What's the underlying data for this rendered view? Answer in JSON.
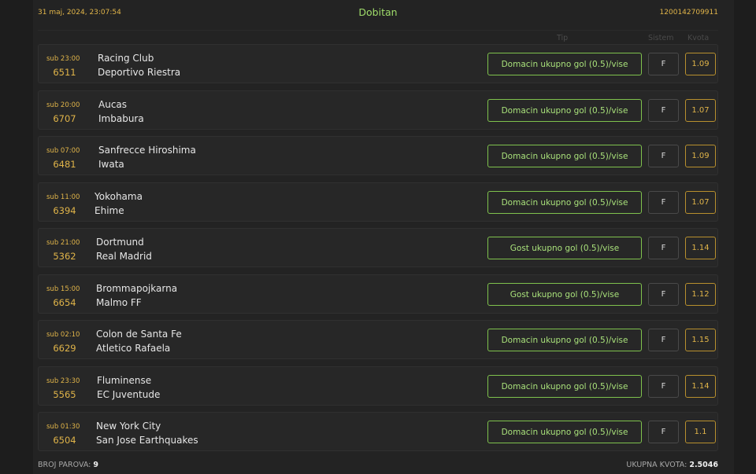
{
  "header": {
    "datetime": "31 maj, 2024, 23:07:54",
    "status": "Dobitan",
    "ticket_id": "1200142709911"
  },
  "columns": {
    "tip": "Tip",
    "sistem": "Sistem",
    "kvota": "Kvota"
  },
  "colors": {
    "accent_green": "#7fc24d",
    "accent_gold": "#e0b449",
    "background": "#1d1d1d"
  },
  "rows": [
    {
      "time": "sub 23:00",
      "code": "6511",
      "home": "Racing Club",
      "away": "Deportivo Riestra",
      "tip": "Domacin ukupno gol (0.5)/vise",
      "sistem": "F",
      "kvota": "1.09"
    },
    {
      "time": "sub 20:00",
      "code": "6707",
      "home": "Aucas",
      "away": "Imbabura",
      "tip": "Domacin ukupno gol (0.5)/vise",
      "sistem": "F",
      "kvota": "1.07"
    },
    {
      "time": "sub 07:00",
      "code": "6481",
      "home": "Sanfrecce Hiroshima",
      "away": "Iwata",
      "tip": "Domacin ukupno gol (0.5)/vise",
      "sistem": "F",
      "kvota": "1.09"
    },
    {
      "time": "sub 11:00",
      "code": "6394",
      "home": "Yokohama",
      "away": "Ehime",
      "tip": "Domacin ukupno gol (0.5)/vise",
      "sistem": "F",
      "kvota": "1.07"
    },
    {
      "time": "sub 21:00",
      "code": "5362",
      "home": "Dortmund",
      "away": "Real Madrid",
      "tip": "Gost ukupno gol (0.5)/vise",
      "sistem": "F",
      "kvota": "1.14"
    },
    {
      "time": "sub 15:00",
      "code": "6654",
      "home": "Brommapojkarna",
      "away": "Malmo FF",
      "tip": "Gost ukupno gol (0.5)/vise",
      "sistem": "F",
      "kvota": "1.12"
    },
    {
      "time": "sub 02:10",
      "code": "6629",
      "home": "Colon de Santa Fe",
      "away": "Atletico Rafaela",
      "tip": "Domacin ukupno gol (0.5)/vise",
      "sistem": "F",
      "kvota": "1.15"
    },
    {
      "time": "sub 23:30",
      "code": "5565",
      "home": "Fluminense",
      "away": "EC Juventude",
      "tip": "Domacin ukupno gol (0.5)/vise",
      "sistem": "F",
      "kvota": "1.14"
    },
    {
      "time": "sub 01:30",
      "code": "6504",
      "home": "New York City",
      "away": "San Jose Earthquakes",
      "tip": "Domacin ukupno gol (0.5)/vise",
      "sistem": "F",
      "kvota": "1.1"
    }
  ],
  "footer": {
    "pairs_label": "BROJ PAROVA:",
    "pairs_value": "9",
    "total_label": "UKUPNA KVOTA:",
    "total_value": "2.5046"
  }
}
